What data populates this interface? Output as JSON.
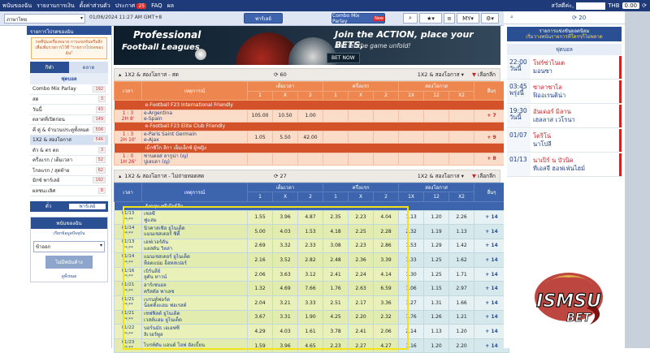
{
  "topnav": {
    "items": [
      "พนันของฉัน",
      "รายงานการเงิน",
      "ตั้งค่าส่วนตัว",
      "ประกาศ",
      "FAQ",
      "ผล"
    ],
    "announce_count": "25",
    "greeting": "สวัสดีค่ะ,",
    "currency": "THB",
    "balance": "0.00"
  },
  "secondbar": {
    "language": "ภาษาไทย",
    "datetime": "01/06/2024 11:27 AM GMT+8",
    "tabs": [
      "พาร์เลย์",
      "Combo Mix Parlay"
    ],
    "new_label": "New",
    "odds_type": "MY"
  },
  "left": {
    "betslip_header": "รายการโปรดของฉัน",
    "note": "กดที่ปุ่มเครื่องหมาย การแข่งขันหรือลีกเพื่อเพิ่มรายการไว้ที่ \"รายการโปรดของฉัน\"",
    "tabs": [
      "กีฬา",
      "ตลาด"
    ],
    "sport": "ฟุตบอล",
    "items": [
      {
        "label": "Combo Mix Parlay",
        "count": "192"
      },
      {
        "label": "สด",
        "count": "3"
      },
      {
        "label": "วันนี้",
        "count": "43"
      },
      {
        "label": "ตลาดที่เปิดก่อน",
        "count": "149"
      },
      {
        "label": "คี่ คู่ & จำนวนประตูทั้งหมด",
        "count": "506"
      },
      {
        "label": "1X2 & สองโอกาส",
        "count": "546"
      },
      {
        "label": "ตัว & ตร ตถ",
        "count": "3"
      },
      {
        "label": "ครึ่งแรก / เต็มเวลา",
        "count": "52"
      },
      {
        "label": "โกลแรก / สุดท้าย",
        "count": "62"
      },
      {
        "label": "มิกซ์ พาร์เลย์",
        "count": "192"
      },
      {
        "label": "ผลชนะเลิศ",
        "count": "8"
      }
    ],
    "dropdown": [
      "ตั๋ว",
      "พาร์เลย์"
    ],
    "betbox": {
      "header": "พนันของฉัน",
      "sub": "เรียกข้อมูลปัจจุบัน",
      "select": "ข้าออก",
      "no_bet": "ไม่มีพนันค้าง",
      "link": "ดูทั้งหมด"
    }
  },
  "banner": {
    "title1": "Professional",
    "title2": "Football Leagues",
    "tagline": "Join the ACTION, place your BETS,",
    "sub": "and let the game unfold!",
    "button": "BET NOW"
  },
  "live": {
    "title": "1X2 & สองโอกาส - สด",
    "count": "60",
    "market": "1X2 & สองโอกาส",
    "select_league": "เลือกลีก",
    "headers": {
      "time": "เวลา",
      "event": "เหตุการณ์",
      "ft": "เต็มเวลา",
      "ht": "ครึ่งแรก",
      "dc": "สองโอกาส",
      "more": "อื่นๆ",
      "c1": "1",
      "cx": "X",
      "c2": "2",
      "d1x": "1X",
      "d12": "12",
      "dx2": "X2"
    },
    "groups": [
      {
        "league": "e-Football F23 International Friendly",
        "matches": [
          {
            "score": "1 : 3",
            "time": "2H 8'",
            "home": "e-Argentina",
            "away": "e-Spain",
            "ft": [
              "105.00",
              "10.50",
              "1.00"
            ],
            "ht": [
              "",
              "",
              ""
            ],
            "dc": [
              "",
              "",
              ""
            ],
            "more": "+ 7"
          }
        ]
      },
      {
        "league": "e-Football F23 Elite Club Friendly",
        "matches": [
          {
            "score": "1 : 3",
            "time": "2H 10'",
            "home": "e-Paris Saint Germain",
            "away": "e-Ajax",
            "ft": [
              "1.05",
              "5.50",
              "42.00"
            ],
            "ht": [
              "",
              "",
              ""
            ],
            "dc": [
              "",
              "",
              ""
            ],
            "more": "+ 9"
          }
        ]
      },
      {
        "league": "เม็กซิโก ลีกา เอ็มเอ็กซ์ ผู้หญิง",
        "matches": [
          {
            "score": "1 : 0",
            "time": "1H 26'",
            "home": "ซานตอส ลากูน่า (ญ)",
            "away": "ปูเอบลา (ญ)",
            "ft": [
              "",
              "",
              ""
            ],
            "ht": [
              "",
              "",
              ""
            ],
            "dc": [
              "",
              "",
              ""
            ],
            "more": "+ 8"
          }
        ]
      }
    ]
  },
  "dead": {
    "title": "1X2 & สองโอกาส - ไม่ถ่ายทอดสด",
    "count": "27",
    "market": "1X2 & สองโอกาส",
    "select_league": "เลือกลีก",
    "league": "อังกฤษ พรีเมียร์ลีก",
    "matches": [
      {
        "date": "01/13",
        "time": "**:**",
        "home": "เชลซี",
        "away": "ฟูแล่ม",
        "ft": [
          "1.55",
          "3.96",
          "4.87"
        ],
        "ht": [
          "2.35",
          "2.23",
          "4.04"
        ],
        "dc": [
          "1.13",
          "1.20",
          "2.26"
        ],
        "more": "+ 14"
      },
      {
        "date": "01/14",
        "time": "**:**",
        "home": "นิวคาสเซิ่ล ยูไนเต็ด",
        "away": "แมนเชสเตอร์ ซิตี้",
        "ft": [
          "5.00",
          "4.03",
          "1.53"
        ],
        "ht": [
          "4.18",
          "2.25",
          "2.28"
        ],
        "dc": [
          "2.32",
          "1.19",
          "1.13"
        ],
        "more": "+ 14"
      },
      {
        "date": "01/13",
        "time": "**:**",
        "home": "เอฟเวอร์ตัน",
        "away": "แอสตัน วิลล่า",
        "ft": [
          "2.69",
          "3.32",
          "2.33"
        ],
        "ht": [
          "3.08",
          "2.23",
          "2.86"
        ],
        "dc": [
          "1.53",
          "1.29",
          "1.42"
        ],
        "more": "+ 14"
      },
      {
        "date": "01/14",
        "time": "**:**",
        "home": "แมนเชสเตอร์ ยูไนเต็ด",
        "away": "ท็อตแน่ม ฮ็อทสเปอร์",
        "ft": [
          "2.16",
          "3.52",
          "2.82"
        ],
        "ht": [
          "2.48",
          "2.36",
          "3.39"
        ],
        "dc": [
          "1.33",
          "1.25",
          "1.62"
        ],
        "more": "+ 14"
      },
      {
        "date": "01/16",
        "time": "**:**",
        "home": "เบิร์นลีย์",
        "away": "ลูตัน ทาวน์",
        "ft": [
          "2.06",
          "3.63",
          "3.12"
        ],
        "ht": [
          "2.41",
          "2.24",
          "4.14"
        ],
        "dc": [
          "1.30",
          "1.25",
          "1.71"
        ],
        "more": "+ 14"
      },
      {
        "date": "01/21",
        "time": "**:**",
        "home": "อาร์เซนอล",
        "away": "คริสตัล พาเลซ",
        "ft": [
          "1.32",
          "4.69",
          "7.66"
        ],
        "ht": [
          "1.76",
          "2.63",
          "6.59"
        ],
        "dc": [
          "1.06",
          "1.15",
          "2.97"
        ],
        "more": "+ 14"
      },
      {
        "date": "01/21",
        "time": "**:**",
        "home": "เบรนท์ฟอร์ด",
        "away": "น็อตติ้งแฮม ฟอเรสต์",
        "ft": [
          "2.04",
          "3.21",
          "3.33"
        ],
        "ht": [
          "2.51",
          "2.17",
          "3.36"
        ],
        "dc": [
          "1.27",
          "1.31",
          "1.66"
        ],
        "more": "+ 14"
      },
      {
        "date": "01/21",
        "time": "**:**",
        "home": "เชฟฟิลด์ ยูไนเต็ด",
        "away": "เวสต์แฮม ยูไนเต็ด",
        "ft": [
          "3.67",
          "3.31",
          "1.90"
        ],
        "ht": [
          "4.25",
          "2.20",
          "2.32"
        ],
        "dc": [
          "1.76",
          "1.26",
          "1.21"
        ],
        "more": "+ 14"
      },
      {
        "date": "01/22",
        "time": "**:**",
        "home": "บอร์นมัธ เอเอฟซี",
        "away": "ลิเวอร์พูล",
        "ft": [
          "4.29",
          "4.03",
          "1.61"
        ],
        "ht": [
          "3.78",
          "2.41",
          "2.06"
        ],
        "dc": [
          "2.14",
          "1.13",
          "1.20"
        ],
        "more": "+ 14"
      },
      {
        "date": "01/23",
        "time": "**:**",
        "home": "ไบรท์ตัน แอนด์ โฮฟ อัลเบี้ยน",
        "away": "",
        "ft": [
          "1.59",
          "3.96",
          "4.65"
        ],
        "ht": [
          "2.23",
          "2.27",
          "4.27"
        ],
        "dc": [
          "1.16",
          "1.20",
          "2.20"
        ],
        "more": "+ 14"
      }
    ]
  },
  "right": {
    "search_count": "20",
    "head": "รายการแข่งขันยอดนิยม",
    "sub": "เริ่มวางพนันรายการที่ใครๆก็ไม่พลาด",
    "sport": "ฟุตบอล",
    "matches": [
      {
        "time": "22:00",
        "day": "วันนี้",
        "home": "โฟร์ซ่าไนเต",
        "away": "มอนซา"
      },
      {
        "time": "03:45",
        "day": "พรุ่งนี้",
        "home": "ซาลาซาไล",
        "away": "ฟิออเรนติน่า"
      },
      {
        "time": "19:30",
        "day": "วันนี้",
        "home": "อันเดอร์ มิลาน",
        "away": "เฮลลาส เวโรนา"
      },
      {
        "time": "01/07",
        "day": "",
        "home": "โตริโน่",
        "away": "นาโปลี"
      },
      {
        "time": "01/13",
        "day": "",
        "home": "นาเปิร์ น บัวนิค",
        "away": "ทีเอสจี ฮอฟเฟ่นไฮม์"
      }
    ]
  },
  "logo": {
    "text1": "ISMSU",
    "text2": "BET"
  }
}
